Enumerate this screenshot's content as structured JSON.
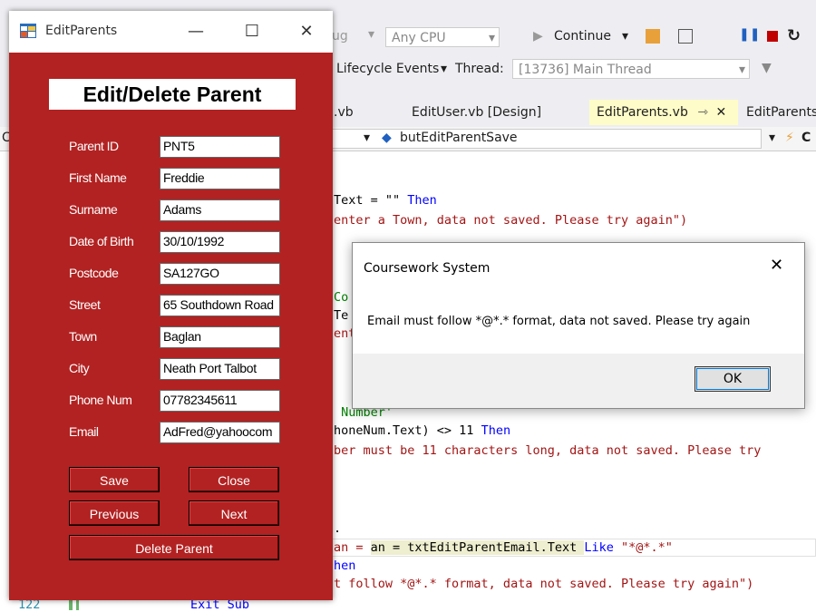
{
  "ide": {
    "toolbar1": {
      "config_partial": "ug",
      "platform": "Any CPU",
      "continue_label": "Continue"
    },
    "toolbar2": {
      "lifecycle": "Lifecycle Events",
      "thread_label": "Thread:",
      "thread_value": "[13736] Main Thread"
    },
    "tabs": [
      {
        "label": ".vb"
      },
      {
        "label": "EditUser.vb [Design]"
      },
      {
        "label": "EditParents.vb"
      },
      {
        "label": "EditParents"
      }
    ],
    "nav": {
      "left_partial": "C",
      "member": "butEditParentSave",
      "right_partial": "C"
    },
    "code": {
      "line1_a": "Text = \"\" ",
      "line1_b": "Then",
      "line2": "enter a Town, data not saved. Please try again\")",
      "line3": "Co",
      "line4": "Te",
      "line5": "ent",
      "line6": " Number'",
      "line7_a": "honeNum.Text) <> 11 ",
      "line7_b": "Then",
      "line8": "ber must be 11 characters long, data not saved. Please try",
      "line9": ".",
      "line10_a": "an = txtEditParentEmail.Text ",
      "line10_b": "Like",
      "line10_c": " \"*@*.*\"",
      "line11": "hen",
      "line12": "t follow *@*.* format, data not saved. Please try again\")",
      "line13_num": "122",
      "line13": "Exit Sub"
    }
  },
  "form": {
    "window_title": "EditParents",
    "heading": "Edit/Delete Parent",
    "fields": [
      {
        "label": "Parent ID",
        "value": "PNT5"
      },
      {
        "label": "First Name",
        "value": "Freddie"
      },
      {
        "label": "Surname",
        "value": "Adams"
      },
      {
        "label": "Date of Birth",
        "value": "30/10/1992"
      },
      {
        "label": "Postcode",
        "value": "SA127GO"
      },
      {
        "label": "Street",
        "value": "65 Southdown Road"
      },
      {
        "label": "Town",
        "value": "Baglan"
      },
      {
        "label": "City",
        "value": "Neath Port Talbot"
      },
      {
        "label": "Phone Num",
        "value": "07782345611"
      },
      {
        "label": "Email",
        "value": "AdFred@yahoocom"
      }
    ],
    "buttons": {
      "save": "Save",
      "close": "Close",
      "previous": "Previous",
      "next": "Next",
      "delete": "Delete Parent"
    },
    "controls": {
      "minimize": "—",
      "maximize": "☐",
      "close": "✕"
    }
  },
  "dialog": {
    "title": "Coursework System",
    "message": "Email must follow *@*.* format, data not saved. Please try again",
    "ok": "OK",
    "close": "✕"
  },
  "colors": {
    "form_bg": "#b22222",
    "accent": "#007acc",
    "active_tab": "#fefcc8"
  }
}
